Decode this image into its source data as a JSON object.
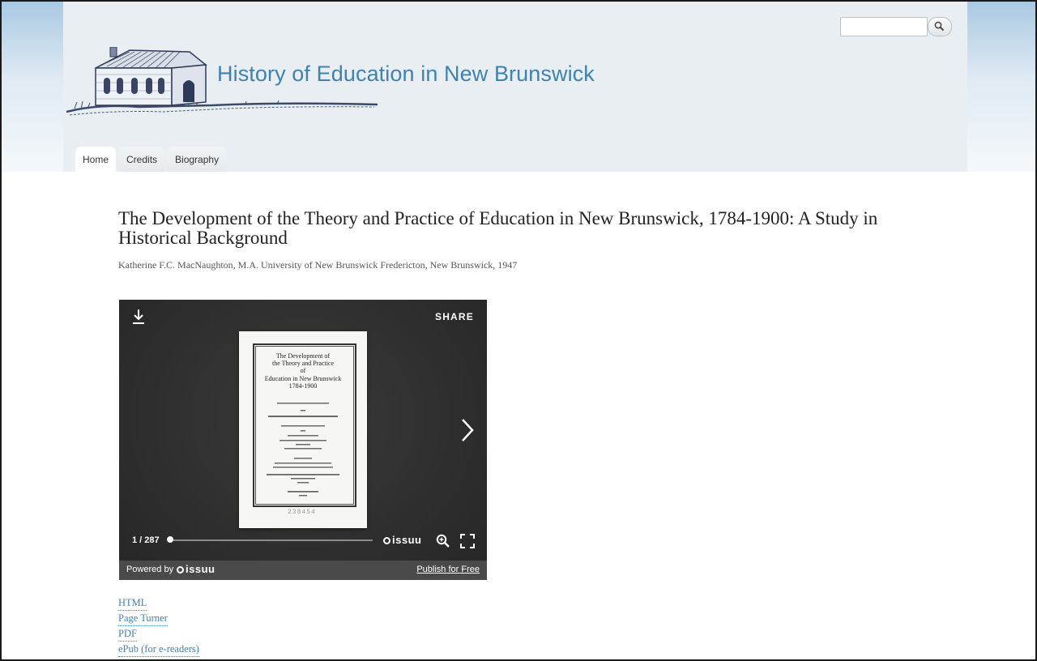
{
  "header": {
    "site_name": "History of Education in New Brunswick",
    "search": {
      "value": "",
      "placeholder": ""
    },
    "tabs": [
      {
        "label": "Home"
      },
      {
        "label": "Credits"
      },
      {
        "label": "Biography"
      }
    ]
  },
  "article": {
    "title": "The Development of the Theory and Practice of Education in New Brunswick, 1784-1900: A Study in Historical Background",
    "byline": "Katherine F.C. MacNaughton, M.A. University of New Brunswick Fredericton, New Brunswick, 1947"
  },
  "viewer": {
    "share_label": "SHARE",
    "page_indicator": "1 / 287",
    "issuu_brand": "issuu",
    "powered_by": "Powered by",
    "publish_link": "Publish for Free",
    "cover": {
      "title_lines": [
        "The Development of",
        "the Theory and Practice",
        "of",
        "Education in New Brunswick",
        "1784-1900"
      ]
    }
  },
  "formats": [
    {
      "label": "HTML"
    },
    {
      "label": "Page Turner"
    },
    {
      "label": "PDF"
    },
    {
      "label": "ePub (for e-readers)"
    }
  ],
  "colors": {
    "link": "#3f82ae",
    "header_bg": "#e8eef1",
    "viewer_bg": "#2f2f2f"
  }
}
